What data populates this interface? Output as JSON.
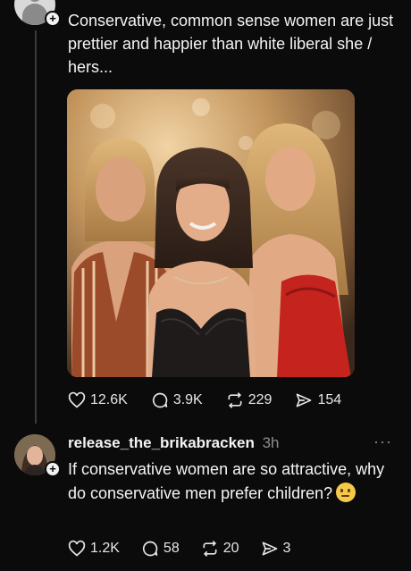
{
  "post": {
    "text": "Conservative, common sense women are just prettier and happier than white liberal she / hers...",
    "stats": {
      "likes": "12.6K",
      "replies": "3.9K",
      "reposts": "229",
      "shares": "154"
    }
  },
  "reply": {
    "username": "release_the_brikabracken",
    "time": "3h",
    "text": "If conservative women are so attractive, why do conservative men prefer children?",
    "emoji": "thinking-face",
    "stats": {
      "likes": "1.2K",
      "replies": "58",
      "reposts": "20",
      "shares": "3"
    }
  },
  "icons": {
    "heart": "heart-icon",
    "reply": "comment-icon",
    "repost": "repost-icon",
    "share": "share-icon",
    "more": "more-icon"
  }
}
